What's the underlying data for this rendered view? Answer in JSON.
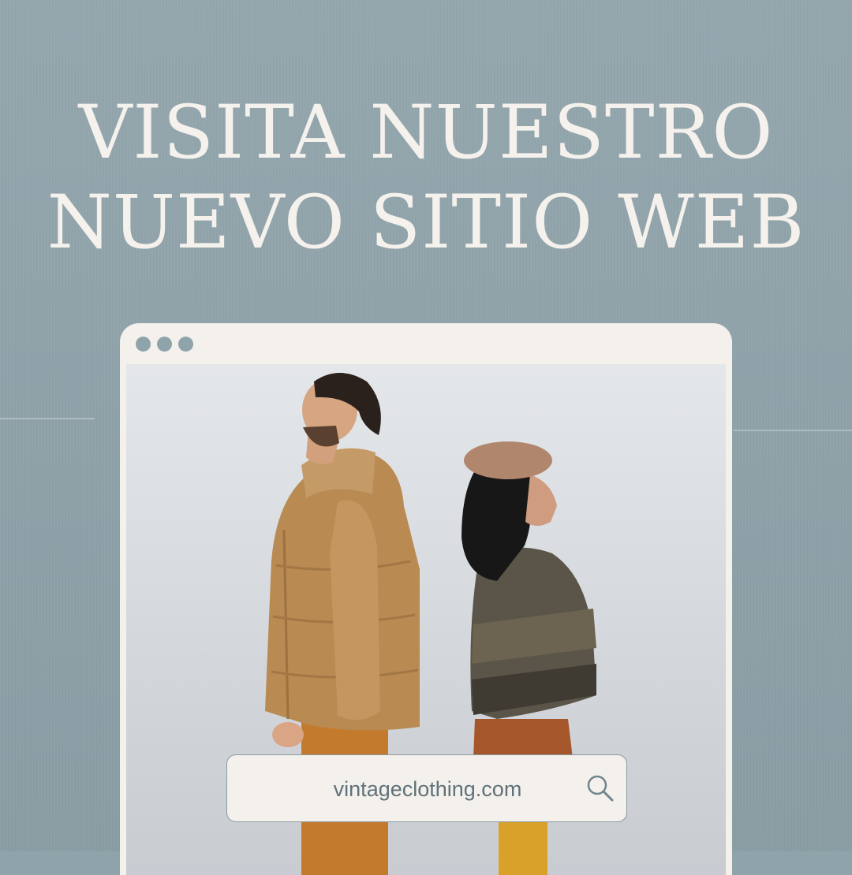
{
  "headline": {
    "line1": "VISITA NUESTRO",
    "line2": "NUEVO SITIO WEB"
  },
  "browser": {
    "window_controls": [
      "dot",
      "dot",
      "dot"
    ]
  },
  "url_bar": {
    "text": "vintageclothing.com",
    "icon": "search-icon"
  },
  "colors": {
    "background": "#8fa3aa",
    "frame": "#f4f1ed",
    "headline": "#f5f1ec",
    "url_text": "#5f7279"
  }
}
